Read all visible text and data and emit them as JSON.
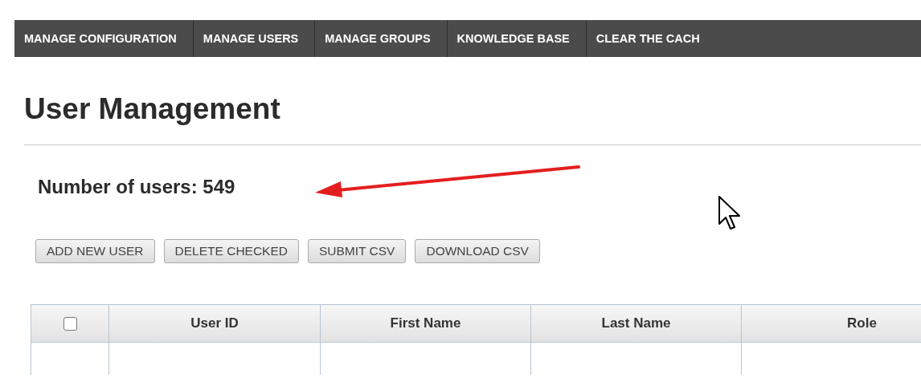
{
  "nav_tabs": [
    {
      "label": "MANAGE CONFIGURATION"
    },
    {
      "label": "MANAGE USERS"
    },
    {
      "label": "MANAGE GROUPS"
    },
    {
      "label": "KNOWLEDGE BASE"
    },
    {
      "label": "CLEAR THE CACH"
    }
  ],
  "title": "User Management",
  "user_count": "Number of users: 549",
  "buttons": [
    {
      "label": "ADD NEW USER"
    },
    {
      "label": "DELETE CHECKED"
    },
    {
      "label": "SUBMIT CSV"
    },
    {
      "label": "DOWNLOAD CSV"
    }
  ],
  "table": {
    "select_all": {
      "checked": false
    },
    "columns": [
      "User ID",
      "First Name",
      "Last Name",
      "Role"
    ]
  }
}
